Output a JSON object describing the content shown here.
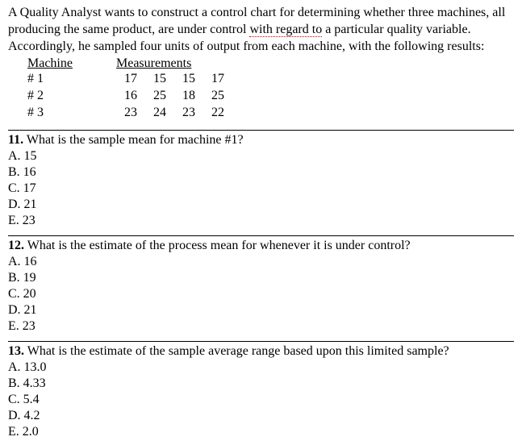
{
  "intro": {
    "part1": "A Quality Analyst wants to construct a control chart for determining whether three machines, all producing the same product, are under control ",
    "dotted": "with regard to",
    "part2": " a particular quality variable. Accordingly, he sampled four units of output from each machine, with the following results:"
  },
  "table": {
    "h1": "Machine",
    "h2": "Measurements",
    "rows": [
      {
        "m": "# 1",
        "v": [
          "17",
          "15",
          "15",
          "17"
        ]
      },
      {
        "m": "# 2",
        "v": [
          "16",
          "25",
          "18",
          "25"
        ]
      },
      {
        "m": "# 3",
        "v": [
          "23",
          "24",
          "23",
          "22"
        ]
      }
    ]
  },
  "q11": {
    "num": "11.",
    "text": " What is the sample mean for machine #1?",
    "a": "A. 15",
    "b": "B. 16",
    "c": "C. 17",
    "d": "D. 21",
    "e": "E. 23"
  },
  "q12": {
    "num": "12.",
    "text": " What is the estimate of the process mean for whenever it is under control?",
    "a": "A. 16",
    "b": "B. 19",
    "c": "C. 20",
    "d": "D. 21",
    "e": "E. 23"
  },
  "q13": {
    "num": "13.",
    "text": " What is the estimate of the sample average range based upon this limited sample?",
    "a": "A. 13.0",
    "b": "B. 4.33",
    "c": "C. 5.4",
    "d": "D. 4.2",
    "e": "E. 2.0"
  }
}
